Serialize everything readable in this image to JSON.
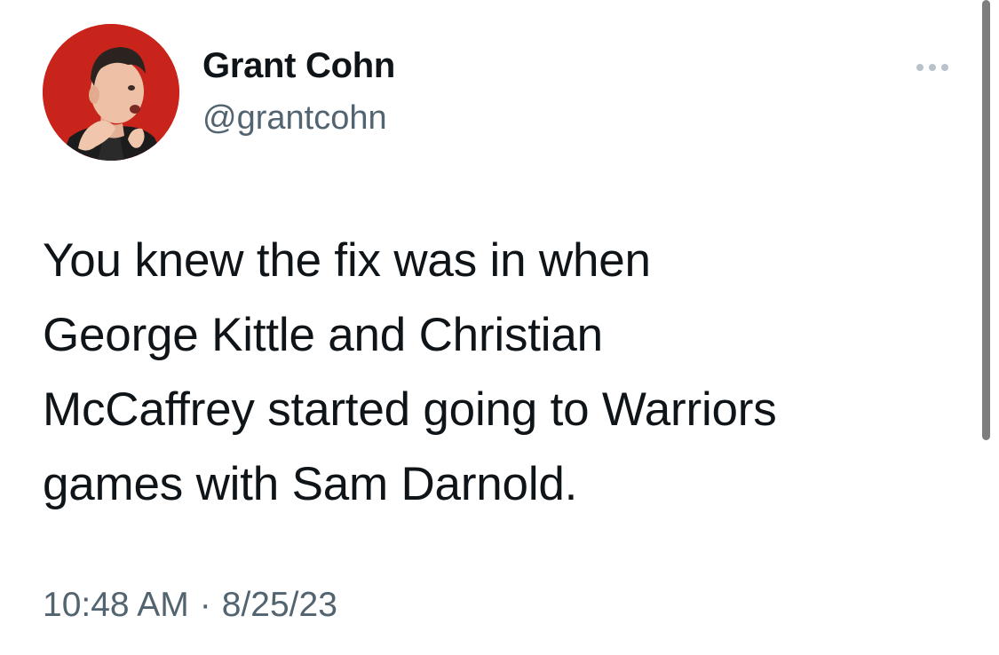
{
  "author": {
    "display_name": "Grant Cohn",
    "handle": "@grantcohn",
    "avatar_icon": "profile-photo",
    "avatar_bg": "#c9241b"
  },
  "tweet": {
    "text_lines": [
      "You knew the fix was in when",
      "George Kittle and Christian",
      "McCaffrey started going to Warriors",
      "games with Sam Darnold."
    ],
    "time": "10:48 AM",
    "separator": "·",
    "date": "8/25/23"
  },
  "menu": {
    "icon": "more-horizontal-icon"
  },
  "colors": {
    "primary_text": "#0f1419",
    "secondary_text": "#536471"
  }
}
